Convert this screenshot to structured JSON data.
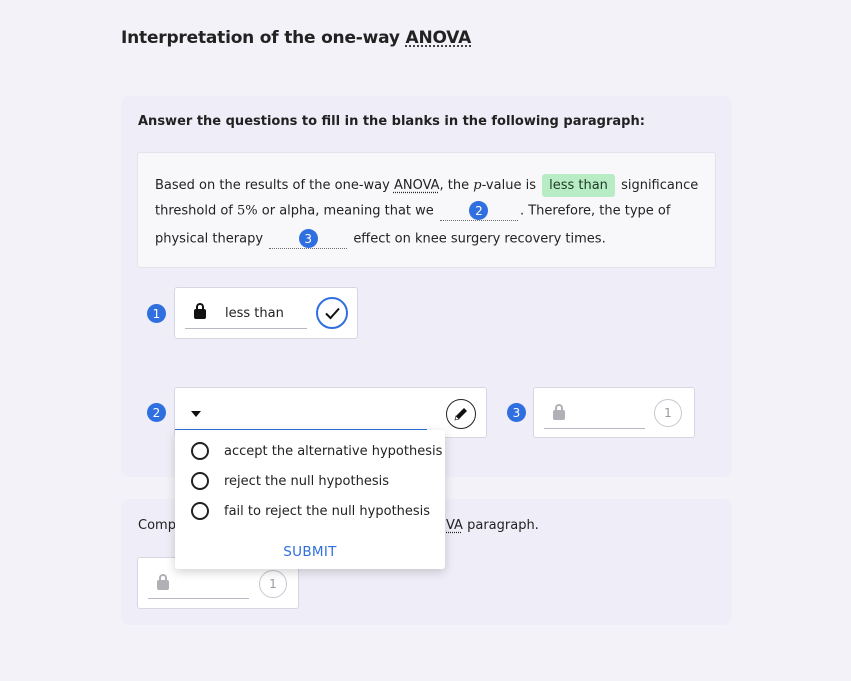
{
  "page": {
    "title_prefix": "Interpretation of the one-way ",
    "title_abbr": "ANOVA"
  },
  "question_card": {
    "instruction": "Answer the questions to fill in the blanks in the following paragraph:",
    "paragraph": {
      "l1_a": "Based on the results of the one-way ",
      "l1_abbr": "ANOVA",
      "l1_b": ", the ",
      "l1_p": "p",
      "l1_c": "-value is ",
      "l1_answer": "less than",
      "l1_d": " significance",
      "l2_a": "threshold of ",
      "l2_pct": "5%",
      "l2_b": " or alpha, meaning that we",
      "l2_blank_num": "2",
      "l2_c": ". Therefore, the type of",
      "l3_a": "physical therapy",
      "l3_blank_num": "3",
      "l3_b": "effect on knee surgery recovery times."
    },
    "q1": {
      "num": "1",
      "value": "less than",
      "status": "correct"
    },
    "q2": {
      "num": "2",
      "selected": "",
      "options": [
        "accept the alternative hypothesis",
        "reject the null hypothesis",
        "fail to reject the null hypothesis"
      ],
      "submit_label": "SUBMIT"
    },
    "q3": {
      "num": "3",
      "attempts": "1"
    }
  },
  "bottom_card": {
    "text_start": "Comp",
    "text_abbr_tail": "VA",
    "text_end": " paragraph.",
    "attempts": "1"
  },
  "colors": {
    "accent": "#2f6fe0",
    "correct_highlight": "#b8ecc4",
    "background": "#f3f2f8",
    "card": "#efedf7"
  }
}
